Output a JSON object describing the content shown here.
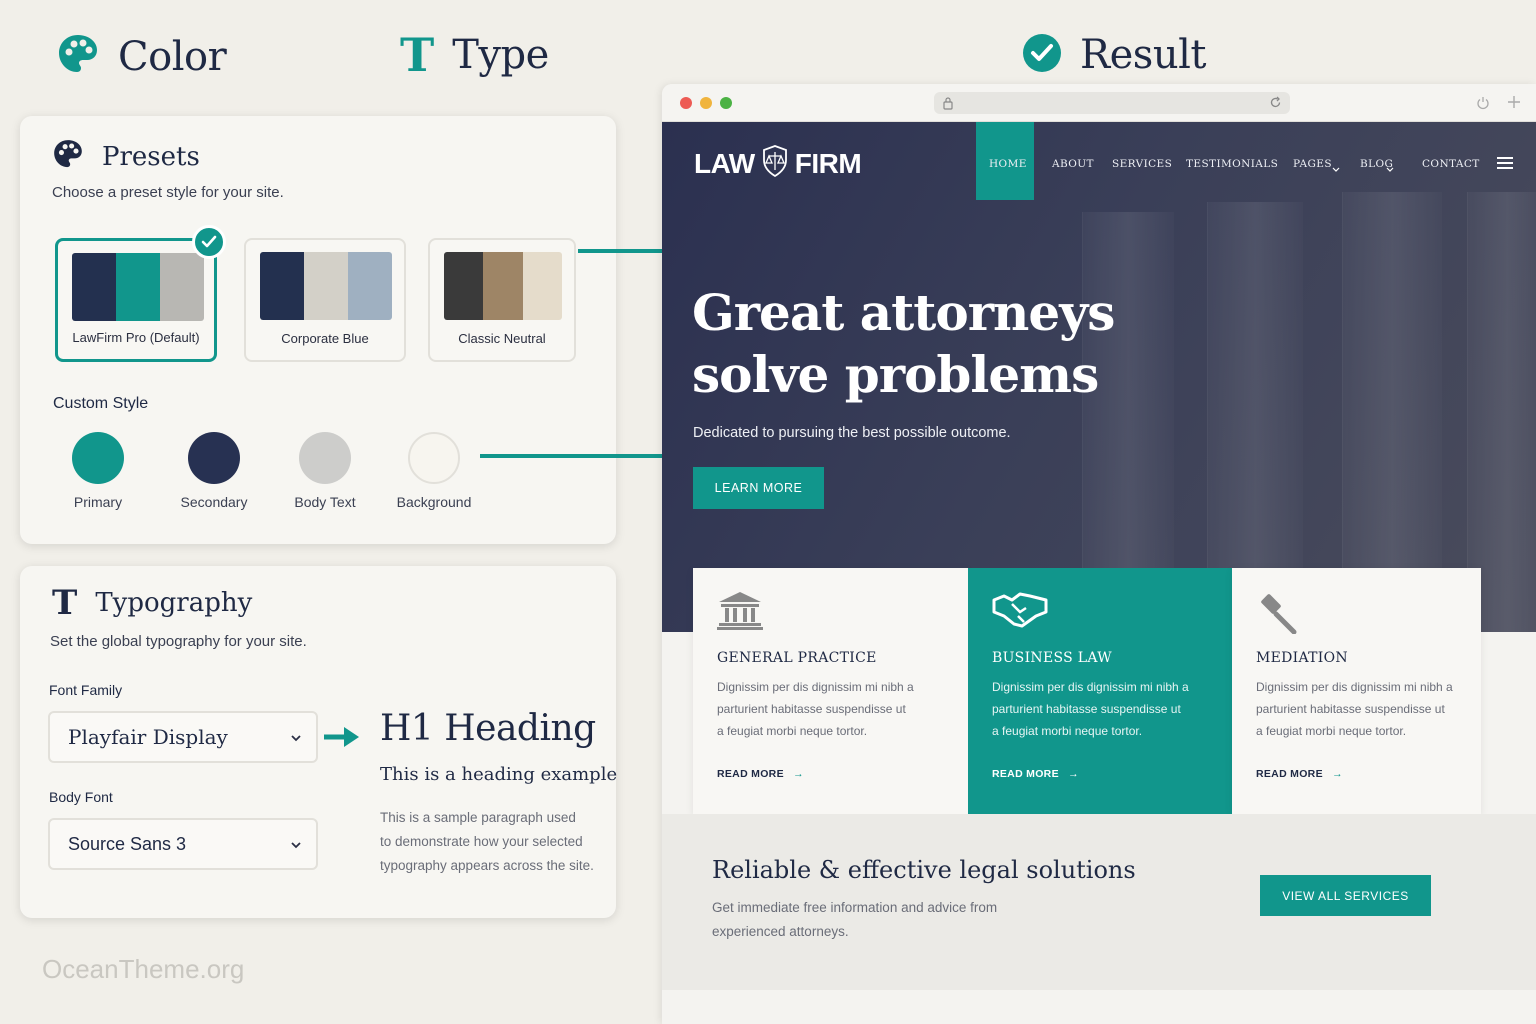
{
  "headers": {
    "color": "Color",
    "type": "Type",
    "result": "Result"
  },
  "presets_panel": {
    "title": "Presets",
    "subtitle": "Choose a preset style for your site.",
    "presets": [
      {
        "name": "LawFirm Pro (Default)",
        "colors": [
          "#23304f",
          "#11968c",
          "#b8b7b3"
        ],
        "selected": true
      },
      {
        "name": "Corporate Blue",
        "colors": [
          "#23304f",
          "#d3d0c8",
          "#9fb0c1"
        ],
        "selected": false
      },
      {
        "name": "Classic Neutral",
        "colors": [
          "#3a3a3a",
          "#9e8566",
          "#e5dccb"
        ],
        "selected": false
      }
    ],
    "custom_style_label": "Custom Style",
    "swatches": [
      {
        "label": "Primary",
        "color": "#11968c"
      },
      {
        "label": "Secondary",
        "color": "#273152"
      },
      {
        "label": "Body Text",
        "color": "#cdcdcb"
      },
      {
        "label": "Background",
        "color": "#f7f5ef"
      }
    ]
  },
  "typography_panel": {
    "title": "Typography",
    "subtitle": "Set the global typography for your site.",
    "font_family_label": "Font Family",
    "font_family_value": "Playfair Display",
    "body_font_label": "Body Font",
    "body_font_value": "Source Sans 3",
    "preview": {
      "h1": "H1 Heading",
      "heading": "This is a heading example",
      "paragraph_lines": [
        "This is a sample paragraph used",
        "to demonstrate how your selected",
        "typography appears across the site."
      ]
    }
  },
  "watermark": "OceanTheme.org",
  "site": {
    "logo_left": "LAW",
    "logo_right": "FIRM",
    "nav": [
      "HOME",
      "ABOUT",
      "SERVICES",
      "TESTIMONIALS",
      "PAGES",
      "BLOG",
      "CONTACT"
    ],
    "hero_title_line1": "Great attorneys",
    "hero_title_line2": "solve problems",
    "hero_subtitle": "Dedicated to pursuing the best possible outcome.",
    "hero_button": "LEARN MORE",
    "services": [
      {
        "title": "GENERAL PRACTICE",
        "icon": "courthouse-icon",
        "lines": [
          "Dignissim per dis dignissim mi nibh a",
          "parturient habitasse suspendisse ut",
          "a feugiat morbi neque tortor."
        ],
        "more": "READ MORE"
      },
      {
        "title": "BUSINESS LAW",
        "icon": "handshake-icon",
        "lines": [
          "Dignissim per dis dignissim mi nibh a",
          "parturient habitasse suspendisse ut",
          "a feugiat morbi neque tortor."
        ],
        "more": "READ MORE"
      },
      {
        "title": "MEDIATION",
        "icon": "gavel-icon",
        "lines": [
          "Dignissim per dis dignissim mi nibh a",
          "parturient habitasse suspendisse ut",
          "a feugiat morbi neque tortor."
        ],
        "more": "READ MORE"
      }
    ],
    "cta_title": "Reliable & effective legal solutions",
    "cta_text_line1": "Get immediate free information and advice from",
    "cta_text_line2": "experienced attorneys.",
    "cta_button": "VIEW ALL SERVICES"
  },
  "colors": {
    "teal": "#11968c",
    "navy": "#1f2944",
    "page_bg": "#f1efe9"
  }
}
